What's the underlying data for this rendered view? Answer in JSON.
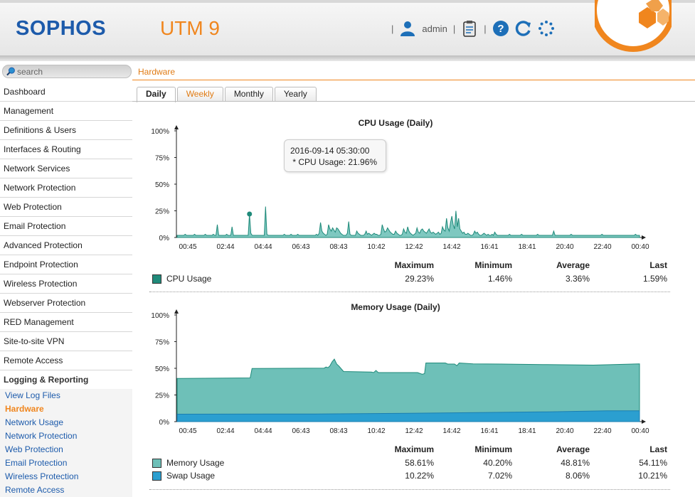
{
  "header": {
    "logo": "SOPHOS",
    "product": "UTM 9",
    "user": "admin"
  },
  "search": {
    "placeholder": "search"
  },
  "breadcrumb": "Hardware",
  "nav": {
    "items": [
      "Dashboard",
      "Management",
      "Definitions & Users",
      "Interfaces & Routing",
      "Network Services",
      "Network Protection",
      "Web Protection",
      "Email Protection",
      "Advanced Protection",
      "Endpoint Protection",
      "Wireless Protection",
      "Webserver Protection",
      "RED Management",
      "Site-to-site VPN",
      "Remote Access"
    ],
    "group": "Logging & Reporting",
    "sub_items": [
      "View Log Files",
      "Hardware",
      "Network Usage",
      "Network Protection",
      "Web Protection",
      "Email Protection",
      "Wireless Protection",
      "Remote Access"
    ],
    "current_sub": "Hardware"
  },
  "tabs": [
    {
      "label": "Daily",
      "active": true
    },
    {
      "label": "Weekly",
      "active": false
    },
    {
      "label": "Monthly",
      "active": false
    },
    {
      "label": "Yearly",
      "active": false
    }
  ],
  "tooltip": {
    "line1": "2016-09-14 05:30:00",
    "line2": " * CPU Usage: 21.96%"
  },
  "stats_headers": [
    "Maximum",
    "Minimum",
    "Average",
    "Last"
  ],
  "colors": {
    "cpu": "#1f8a7a",
    "memory": "#6ec0b8",
    "swap": "#2b9fd0",
    "accent": "#f0861e",
    "brand": "#1d5bab"
  },
  "chart_data": [
    {
      "type": "area",
      "title": "CPU Usage (Daily)",
      "x": [
        "00:45",
        "02:44",
        "04:44",
        "06:43",
        "08:43",
        "10:42",
        "12:42",
        "14:42",
        "16:41",
        "18:41",
        "20:40",
        "22:40",
        "00:40"
      ],
      "yticks": [
        "100%",
        "75%",
        "50%",
        "25%",
        "0%"
      ],
      "ylim": [
        0,
        100
      ],
      "series": [
        {
          "name": "CPU Usage",
          "values": [
            2,
            2,
            2,
            2,
            2,
            2,
            3,
            2,
            2,
            2,
            2,
            2,
            2,
            3,
            2,
            2,
            2,
            2,
            2,
            2,
            2,
            3,
            2,
            2,
            2,
            2,
            2,
            3,
            2,
            2,
            12,
            2,
            2,
            2,
            2,
            2,
            2,
            3,
            2,
            2,
            2,
            10,
            2,
            2,
            2,
            2,
            2,
            2,
            2,
            2,
            2,
            2,
            2,
            2,
            22,
            4,
            2,
            2,
            2,
            2,
            2,
            2,
            2,
            2,
            2,
            2,
            29,
            3,
            2,
            2,
            2,
            2,
            2,
            2,
            2,
            2,
            2,
            2,
            2,
            2,
            3,
            2,
            2,
            2,
            2,
            3,
            2,
            2,
            2,
            2,
            3,
            2,
            2,
            2,
            2,
            2,
            2,
            2,
            2,
            2,
            2,
            2,
            2,
            2,
            3,
            2,
            4,
            14,
            6,
            4,
            3,
            2,
            3,
            12,
            8,
            6,
            9,
            7,
            5,
            9,
            8,
            6,
            4,
            3,
            2,
            2,
            2,
            4,
            15,
            3,
            2,
            2,
            2,
            2,
            6,
            4,
            3,
            2,
            2,
            2,
            3,
            6,
            3,
            4,
            3,
            2,
            3,
            4,
            3,
            3,
            2,
            2,
            3,
            12,
            8,
            5,
            6,
            9,
            7,
            5,
            4,
            3,
            3,
            6,
            4,
            3,
            2,
            2,
            3,
            8,
            5,
            4,
            10,
            6,
            4,
            3,
            2,
            3,
            4,
            9,
            5,
            4,
            7,
            8,
            6,
            5,
            4,
            6,
            8,
            5,
            4,
            5,
            4,
            3,
            4,
            5,
            3,
            4,
            10,
            7,
            6,
            18,
            9,
            6,
            14,
            20,
            12,
            8,
            25,
            10,
            18,
            8,
            6,
            4,
            5,
            3,
            3,
            4,
            3,
            2,
            2,
            3,
            6,
            4,
            5,
            3,
            2,
            2,
            3,
            4,
            3,
            2,
            3,
            2,
            2,
            3,
            2,
            5,
            3,
            2,
            2,
            2,
            2,
            2,
            2,
            2,
            2,
            2,
            3,
            2,
            2,
            2,
            2,
            2,
            2,
            2,
            2,
            3,
            2,
            2,
            2,
            2,
            2,
            2,
            2,
            2,
            2,
            2,
            2,
            3,
            2,
            2,
            2,
            2,
            2,
            2,
            2,
            2,
            2,
            2,
            2,
            6,
            2,
            2,
            2,
            2,
            2,
            2,
            2,
            2,
            2,
            2,
            2,
            2,
            3,
            2,
            2,
            2,
            2,
            2,
            2,
            2,
            2,
            2,
            2,
            2,
            2,
            2,
            2,
            2,
            2,
            2,
            2,
            2,
            2,
            2,
            2,
            3,
            2,
            2,
            2,
            2,
            2,
            2,
            2,
            2,
            2,
            2,
            2,
            2,
            2,
            2,
            2,
            2,
            2,
            2,
            2,
            2,
            2,
            2,
            2,
            2,
            3,
            2,
            2,
            2
          ]
        }
      ],
      "stats": [
        {
          "name": "CPU Usage",
          "max": "29.23%",
          "min": "1.46%",
          "avg": "3.36%",
          "last": "1.59%"
        }
      ]
    },
    {
      "type": "area",
      "title": "Memory Usage (Daily)",
      "x": [
        "00:45",
        "02:44",
        "04:44",
        "06:43",
        "08:43",
        "10:42",
        "12:42",
        "14:42",
        "16:41",
        "18:41",
        "20:40",
        "22:40",
        "00:40"
      ],
      "yticks": [
        "100%",
        "75%",
        "50%",
        "25%",
        "0%"
      ],
      "ylim": [
        0,
        100
      ],
      "series": [
        {
          "name": "Memory Usage",
          "points": [
            [
              0,
              40.5
            ],
            [
              0.16,
              40.8
            ],
            [
              0.161,
              49.5
            ],
            [
              0.31,
              50
            ],
            [
              0.32,
              51
            ],
            [
              0.33,
              50.5
            ],
            [
              0.315,
              50
            ],
            [
              0.32,
              51
            ],
            [
              0.32,
              51.2
            ],
            [
              0.325,
              51
            ],
            [
              0.32,
              50.8
            ]
          ]
        },
        {
          "name": "Swap Usage",
          "points": [
            [
              0,
              7
            ],
            [
              0.5,
              8
            ],
            [
              0.6,
              8.5
            ],
            [
              0.9,
              10
            ],
            [
              1,
              10.2
            ]
          ]
        }
      ],
      "stats": [
        {
          "name": "Memory Usage",
          "max": "58.61%",
          "min": "40.20%",
          "avg": "48.81%",
          "last": "54.11%"
        },
        {
          "name": "Swap Usage",
          "max": "10.22%",
          "min": "7.02%",
          "avg": "8.06%",
          "last": "10.21%"
        }
      ]
    }
  ]
}
